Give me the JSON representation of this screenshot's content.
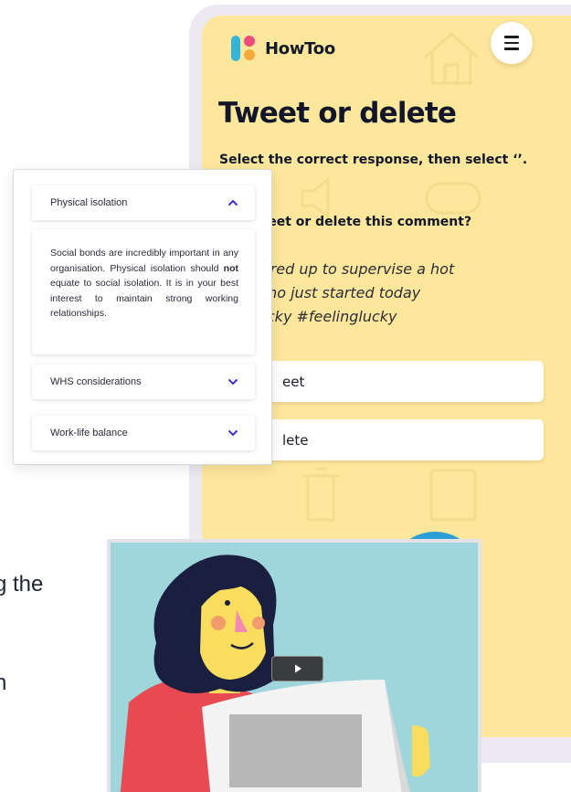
{
  "background_text": {
    "line1": "g the",
    "line2": "n"
  },
  "app": {
    "brand": "HowToo",
    "menu_icon": "hamburger-icon",
    "colors": {
      "screen_bg": "#fde79c",
      "logo_blue": "#33b4d9",
      "logo_pink": "#ef4c7e",
      "logo_orange": "#f6a93b"
    }
  },
  "quiz": {
    "title": "Tweet or delete",
    "instruction": "Select the correct response, then select ‘’.",
    "question": "you tweet or delete this comment?",
    "quote": {
      "line1": "got paired up to supervise a hot",
      "line2": "who just started today",
      "line3": "ttinglucky #feelinglucky"
    },
    "options": [
      "eet",
      "lete"
    ]
  },
  "accordion": {
    "items": [
      {
        "label": "Physical isolation",
        "expanded": true,
        "icon": "chevron-up-icon"
      },
      {
        "label": "WHS considerations",
        "expanded": false,
        "icon": "chevron-down-icon"
      },
      {
        "label": "Work-life balance",
        "expanded": false,
        "icon": "chevron-down-icon"
      }
    ],
    "body": {
      "before": "Social bonds are incredibly important in any organisation. Physical isolation should ",
      "bold": "not",
      "after": " equate to social isolation. It is in your best interest to maintain strong working relationships."
    },
    "chevron_color": "#3b2ad6"
  },
  "video": {
    "play_icon": "play-icon"
  }
}
